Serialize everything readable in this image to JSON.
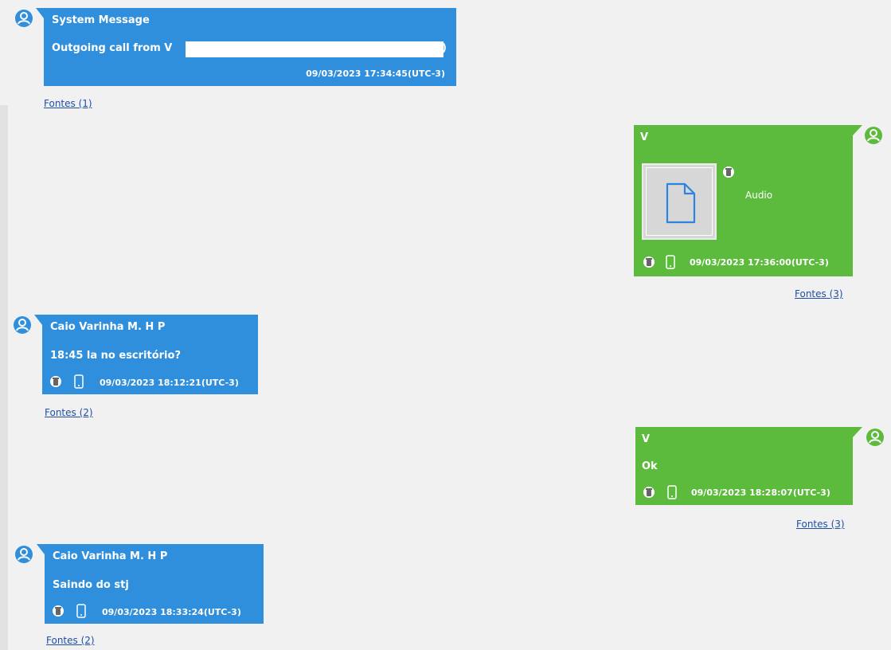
{
  "messages": [
    {
      "sender": "System Message",
      "text": "Outgoing call from V",
      "text_tail": ")",
      "timestamp": "09/03/2023 17:34:45(UTC-3)",
      "sources": "Fontes (1)"
    },
    {
      "sender": "V",
      "attachment_label": "Audio",
      "attachment_icon": "file-icon",
      "timestamp": "09/03/2023 17:36:00(UTC-3)",
      "sources": "Fontes (3)"
    },
    {
      "sender": "Caio Varinha M. H P",
      "text": "18:45 la no escritório?",
      "timestamp": "09/03/2023 18:12:21(UTC-3)",
      "sources": "Fontes (2)"
    },
    {
      "sender": "V",
      "text": "Ok",
      "timestamp": "09/03/2023 18:28:07(UTC-3)",
      "sources": "Fontes (3)"
    },
    {
      "sender": "Caio Varinha M. H P",
      "text": "Saindo do stj",
      "timestamp": "09/03/2023 18:33:24(UTC-3)",
      "sources": "Fontes (2)"
    }
  ],
  "colors": {
    "incoming_bubble": "#2f8fdc",
    "outgoing_bubble": "#5cba3c",
    "link": "#1f4fa6",
    "background": "#f1f1f1"
  },
  "icons": [
    "user-avatar-icon",
    "trash-icon",
    "phone-device-icon",
    "file-icon"
  ]
}
